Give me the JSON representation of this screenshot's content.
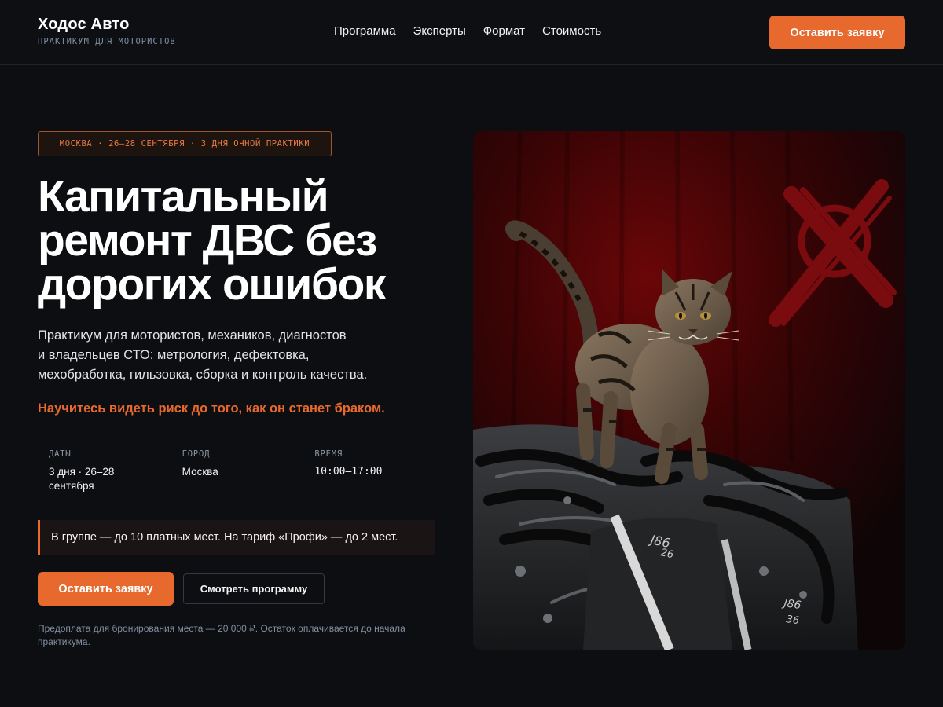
{
  "header": {
    "brand_name": "Ходос Авто",
    "brand_sub": "ПРАКТИКУМ ДЛЯ МОТОРИСТОВ",
    "nav": [
      "Программа",
      "Эксперты",
      "Формат",
      "Стоимость"
    ],
    "cta_label": "Оставить заявку"
  },
  "hero": {
    "badge": "МОСКВА · 26–28 СЕНТЯБРЯ · 3 ДНЯ ОЧНОЙ ПРАКТИКИ",
    "title_lines": [
      "Капитальный",
      "ремонт ДВС без",
      "дорогих ошибок"
    ],
    "lead_lines": [
      "Практикум для мотористов, механиков, диагностов",
      "и владельцев СТО: метрология, дефектовка,",
      "мехобработка, гильзовка, сборка и контроль качества."
    ],
    "accent": "Научитесь видеть риск до того, как он станет браком.",
    "facts": [
      {
        "label": "ДАТЫ",
        "value_lines": [
          "3 дня · 26–28",
          "сентября"
        ]
      },
      {
        "label": "ГОРОД",
        "value_lines": [
          "Москва"
        ]
      },
      {
        "label": "ВРЕМЯ",
        "value_lines": [
          "10:00–17:00"
        ]
      }
    ],
    "notice": "В группе — до 10 платных мест. На тариф «Профи» — до 2 мест.",
    "primary_label": "Оставить заявку",
    "secondary_label": "Смотреть программу",
    "footnote_lines": [
      "Предоплата для бронирования места — 20 000 ₽. Остаток оплачивается до начала",
      "практикума."
    ]
  },
  "photo": {
    "engine_marks": [
      "J86",
      "26",
      "J86",
      "36"
    ]
  },
  "colors": {
    "background": "#0c0e11",
    "accent": "#e8692e",
    "muted": "#8290a0"
  }
}
